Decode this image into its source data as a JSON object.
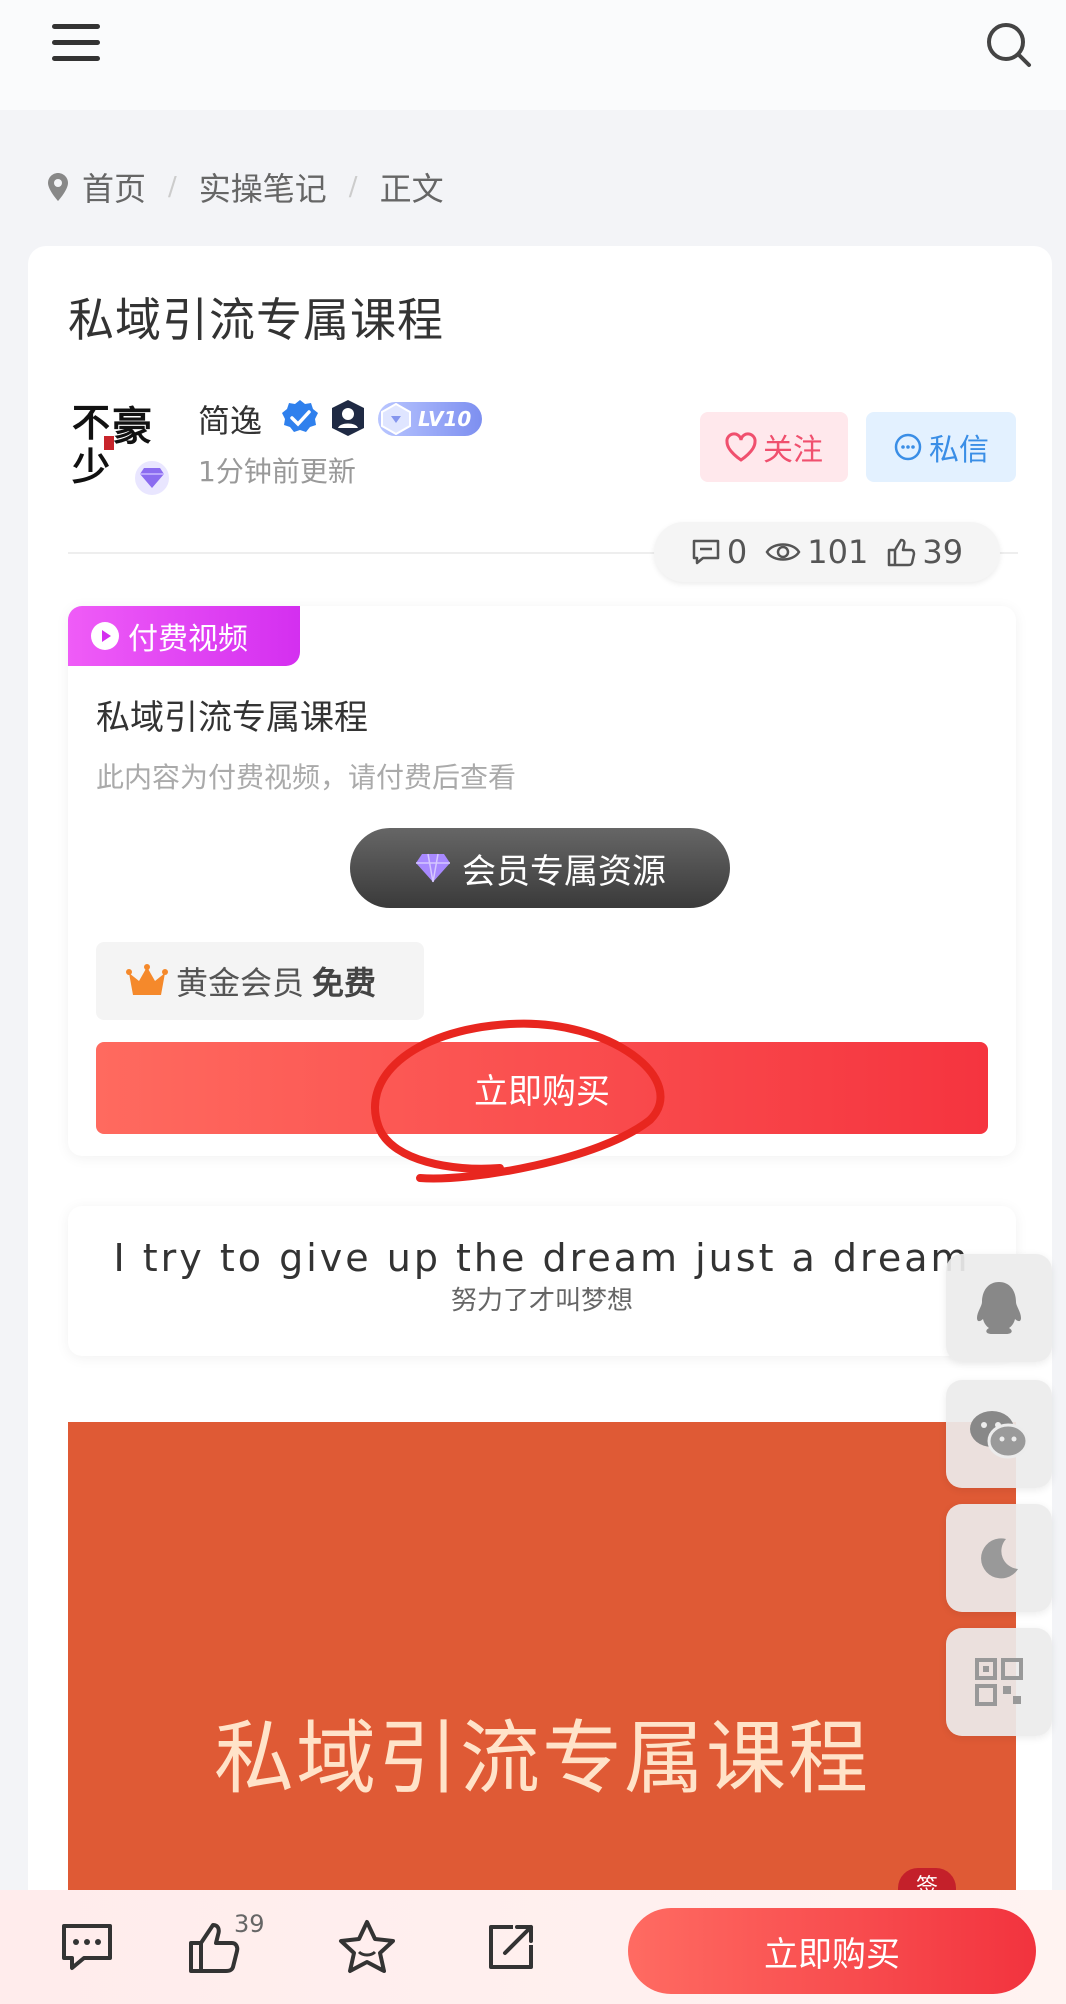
{
  "header": {
    "menu_icon": "hamburger-menu-icon",
    "search_icon": "search-icon"
  },
  "breadcrumb": {
    "items": [
      "首页",
      "实操笔记",
      "正文"
    ],
    "separator": "/"
  },
  "post": {
    "title": "私域引流专属课程",
    "author": {
      "name": "简逸",
      "level": "LV10",
      "updated": "1分钟前更新"
    },
    "follow_label": "关注",
    "message_label": "私信",
    "stats": {
      "comments": "0",
      "views": "101",
      "likes": "39"
    }
  },
  "paid": {
    "tag": "付费视频",
    "title": "私域引流专属课程",
    "description": "此内容为付费视频，请付费后查看",
    "vip_pill": "会员专属资源",
    "member_label": "黄金会员",
    "member_price": "免费",
    "buy_label": "立即购买"
  },
  "quote": {
    "en": "I try to give up the dream just a dream",
    "zh": "努力了才叫梦想"
  },
  "cover": {
    "title": "私域引流专属课程"
  },
  "float_buttons": [
    "qq-icon",
    "wechat-icon",
    "moon-icon",
    "qrcode-icon"
  ],
  "bottom_bar": {
    "like_count": "39",
    "buy_label": "立即购买",
    "badge": "签"
  },
  "colors": {
    "accent_red": "#f5343f",
    "paid_tag": "#d42ff0",
    "cover_bg": "#df5a35",
    "follow": "#f0506e",
    "message": "#3a8ee6"
  }
}
